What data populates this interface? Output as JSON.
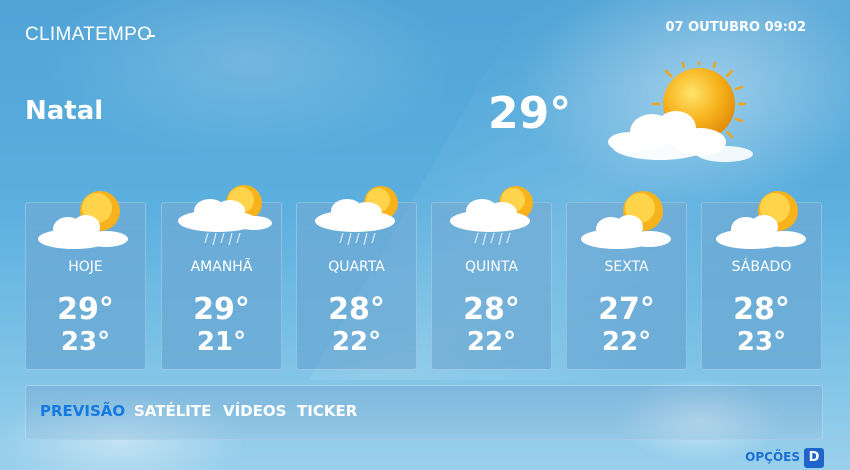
{
  "header": {
    "logo": "CLIMATEMPO",
    "datetime": "07 OUTUBRO 09:02"
  },
  "current": {
    "city": "Natal",
    "temperature": "29°",
    "icon": "sun-with-cloud-icon"
  },
  "forecast": [
    {
      "day": "HOJE",
      "high": "29°",
      "low": "23°",
      "icon": "sun-cloud-icon"
    },
    {
      "day": "AMANHÃ",
      "high": "29°",
      "low": "21°",
      "icon": "sun-cloud-rain-icon"
    },
    {
      "day": "QUARTA",
      "high": "28°",
      "low": "22°",
      "icon": "sun-cloud-rain-icon"
    },
    {
      "day": "QUINTA",
      "high": "28°",
      "low": "22°",
      "icon": "sun-cloud-rain-icon"
    },
    {
      "day": "SEXTA",
      "high": "27°",
      "low": "22°",
      "icon": "sun-cloud-icon"
    },
    {
      "day": "SÁBADO",
      "high": "28°",
      "low": "23°",
      "icon": "sun-cloud-icon"
    }
  ],
  "menu": {
    "items": [
      "PREVISÃO",
      "SATÉLITE",
      "VÍDEOS",
      "TICKER"
    ],
    "active": "PREVISÃO"
  },
  "options": {
    "label": "OPÇÕES",
    "badge": "D"
  },
  "colors": {
    "active": "#1479e0",
    "badge": "#1f64c8",
    "sun": "#f7b21c"
  }
}
